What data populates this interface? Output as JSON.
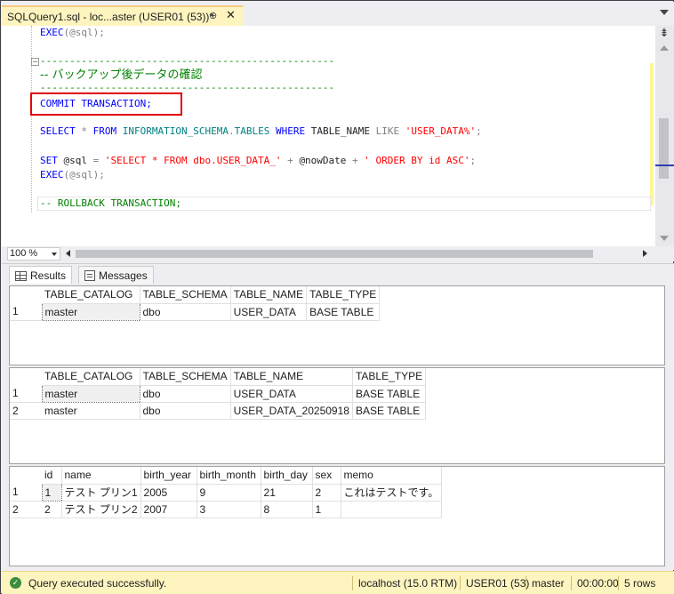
{
  "tab": {
    "title": "SQLQuery1.sql - loc...aster (USER01 (53))*",
    "pin_glyph": "⊕",
    "close_glyph": "✕"
  },
  "editor": {
    "lines": [
      {
        "segments": [
          {
            "t": "EXEC",
            "c": "kw"
          },
          {
            "t": "(@sql);",
            "c": "gray"
          }
        ]
      },
      {
        "segments": [
          {
            "t": "--------------------------------------------------",
            "c": "cmt"
          }
        ]
      },
      {
        "segments": [
          {
            "t": "--------------------------------------------------",
            "c": "cmt"
          }
        ]
      },
      {
        "segments": [
          {
            "t": "COMMIT TRANSACTION;",
            "c": "kw"
          }
        ]
      },
      {
        "segments": [
          {
            "t": "SELECT",
            "c": "kw"
          },
          {
            "t": " * ",
            "c": "gray"
          },
          {
            "t": "FROM",
            "c": "kw"
          },
          {
            "t": " INFORMATION_SCHEMA",
            "c": "obj"
          },
          {
            "t": ".",
            "c": "gray"
          },
          {
            "t": "TABLES",
            "c": "obj"
          },
          {
            "t": " WHERE",
            "c": "kw"
          },
          {
            "t": " TABLE_NAME",
            "c": "txt"
          },
          {
            "t": " LIKE",
            "c": "gray"
          },
          {
            "t": " 'USER_DATA%'",
            "c": "str"
          },
          {
            "t": ";",
            "c": "gray"
          }
        ]
      },
      {
        "segments": [
          {
            "t": "SET",
            "c": "kw"
          },
          {
            "t": " @sql ",
            "c": "txt"
          },
          {
            "t": "=",
            "c": "gray"
          },
          {
            "t": " 'SELECT * FROM dbo.USER_DATA_'",
            "c": "str"
          },
          {
            "t": " + ",
            "c": "gray"
          },
          {
            "t": "@nowDate",
            "c": "txt"
          },
          {
            "t": " + ",
            "c": "gray"
          },
          {
            "t": "' ORDER BY id ASC'",
            "c": "str"
          },
          {
            "t": ";",
            "c": "gray"
          }
        ]
      },
      {
        "segments": [
          {
            "t": "EXEC",
            "c": "kw"
          },
          {
            "t": "(@sql);",
            "c": "gray"
          }
        ]
      },
      {
        "segments": [
          {
            "t": "-- ROLLBACK TRANSACTION;",
            "c": "cmt"
          }
        ]
      }
    ],
    "jp_comment": "-- バックアップ後データの確認",
    "collapse_glyph": "−",
    "split_glyph": "⇟"
  },
  "zoom": {
    "value": "100 %"
  },
  "result_tabs": {
    "results": "Results",
    "messages": "Messages"
  },
  "grid1": {
    "columns": [
      "TABLE_CATALOG",
      "TABLE_SCHEMA",
      "TABLE_NAME",
      "TABLE_TYPE"
    ],
    "rows": [
      [
        "1",
        "master",
        "dbo",
        "USER_DATA",
        "BASE TABLE"
      ]
    ]
  },
  "grid2": {
    "columns": [
      "TABLE_CATALOG",
      "TABLE_SCHEMA",
      "TABLE_NAME",
      "TABLE_TYPE"
    ],
    "rows": [
      [
        "1",
        "master",
        "dbo",
        "USER_DATA",
        "BASE TABLE"
      ],
      [
        "2",
        "master",
        "dbo",
        "USER_DATA_20250918",
        "BASE TABLE"
      ]
    ]
  },
  "grid3": {
    "columns": [
      "id",
      "name",
      "birth_year",
      "birth_month",
      "birth_day",
      "sex",
      "memo"
    ],
    "rows": [
      [
        "1",
        "1",
        "テスト プリン1",
        "2005",
        "9",
        "21",
        "2",
        "これはテストです。"
      ],
      [
        "2",
        "2",
        "テスト プリン2",
        "2007",
        "3",
        "8",
        "1",
        ""
      ]
    ]
  },
  "status": {
    "ok_glyph": "✓",
    "message": "Query executed successfully.",
    "server": "localhost (15.0 RTM)",
    "user": "USER01 (53)",
    "database": "master",
    "elapsed": "00:00:00",
    "rows": "5 rows"
  },
  "colors": {
    "keyword": "#0000ff",
    "string": "#ff0000",
    "comment": "#008000",
    "highlight_box": "#e00000",
    "status_bar": "#fdf4bf"
  }
}
